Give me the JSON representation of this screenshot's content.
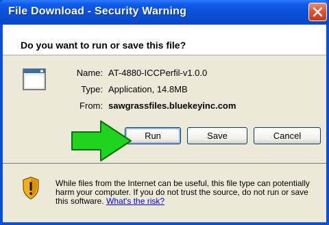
{
  "window": {
    "title": "File Download - Security Warning"
  },
  "dialog": {
    "question": "Do you want to run or save this file?",
    "file": {
      "name_label": "Name:",
      "name_value": "AT-4880-ICCPerfil-v1.0.0",
      "type_label": "Type:",
      "type_value": "Application, 14.8MB",
      "from_label": "From:",
      "from_value": "sawgrassfiles.bluekeyinc.com"
    },
    "buttons": {
      "run": "Run",
      "save": "Save",
      "cancel": "Cancel"
    },
    "warning": {
      "text": "While files from the Internet can be useful, this file type can potentially harm your computer. If you do not trust the source, do not run or save this software.",
      "link": "What's the risk?"
    }
  },
  "colors": {
    "titlebar": "#0a4fd6",
    "close": "#e2512f",
    "dialog_bg": "#ece9d8",
    "arrow": "#1fd31f",
    "link": "#0000ff"
  },
  "icons": [
    "close-icon",
    "application-icon",
    "shield-warning-icon",
    "green-arrow-icon"
  ]
}
